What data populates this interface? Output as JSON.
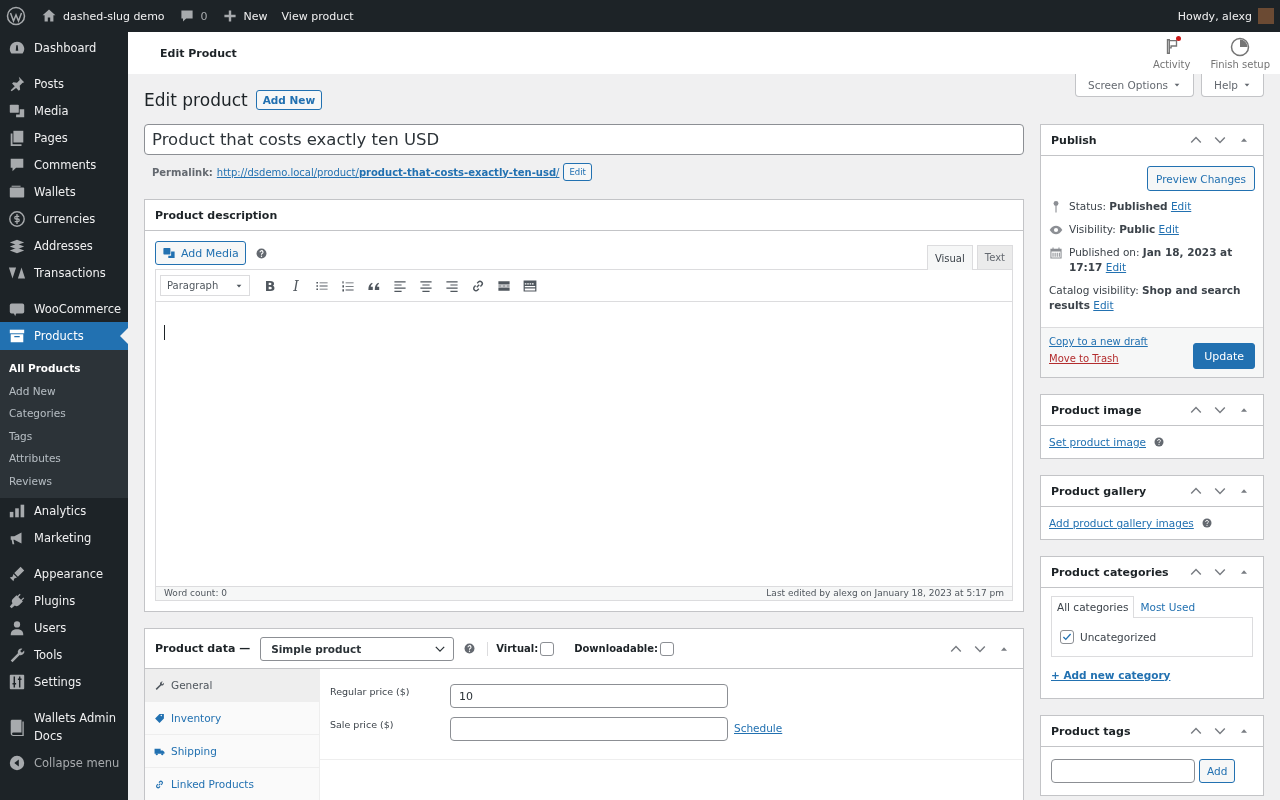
{
  "admin_bar": {
    "site_name": "dashed-slug demo",
    "comments_count": "0",
    "new_label": "New",
    "view_label": "View product",
    "greeting": "Howdy, alexg"
  },
  "sidebar": {
    "items": [
      {
        "kind": "item",
        "label": "Dashboard",
        "selected": false
      },
      {
        "kind": "separator"
      },
      {
        "kind": "item",
        "label": "Posts",
        "selected": false
      },
      {
        "kind": "item",
        "label": "Media",
        "selected": false
      },
      {
        "kind": "item",
        "label": "Pages",
        "selected": false
      },
      {
        "kind": "item",
        "label": "Comments",
        "selected": false
      },
      {
        "kind": "item",
        "label": "Wallets",
        "selected": false
      },
      {
        "kind": "item",
        "label": "Currencies",
        "selected": false
      },
      {
        "kind": "item",
        "label": "Addresses",
        "selected": false
      },
      {
        "kind": "item",
        "label": "Transactions",
        "selected": false
      },
      {
        "kind": "separator"
      },
      {
        "kind": "item",
        "label": "WooCommerce",
        "selected": false
      },
      {
        "kind": "item",
        "label": "Products",
        "selected": true,
        "children": [
          {
            "label": "All Products",
            "selected": true
          },
          {
            "label": "Add New",
            "selected": false
          },
          {
            "label": "Categories",
            "selected": false
          },
          {
            "label": "Tags",
            "selected": false
          },
          {
            "label": "Attributes",
            "selected": false
          },
          {
            "label": "Reviews",
            "selected": false
          }
        ]
      },
      {
        "kind": "item",
        "label": "Analytics",
        "selected": false
      },
      {
        "kind": "item",
        "label": "Marketing",
        "selected": false
      },
      {
        "kind": "separator"
      },
      {
        "kind": "item",
        "label": "Appearance",
        "selected": false
      },
      {
        "kind": "item",
        "label": "Plugins",
        "selected": false
      },
      {
        "kind": "item",
        "label": "Users",
        "selected": false
      },
      {
        "kind": "item",
        "label": "Tools",
        "selected": false
      },
      {
        "kind": "item",
        "label": "Settings",
        "selected": false
      },
      {
        "kind": "separator"
      },
      {
        "kind": "item",
        "label": "Wallets Admin Docs",
        "selected": false
      }
    ],
    "collapse_label": "Collapse menu"
  },
  "header": {
    "title": "Edit Product",
    "activity_label": "Activity",
    "activity_unread": true,
    "finish_setup_label": "Finish setup",
    "screen_options_label": "Screen Options",
    "help_label": "Help"
  },
  "heading": {
    "title": "Edit product",
    "add_new_label": "Add New"
  },
  "title_field": {
    "value": "Product that costs exactly ten USD"
  },
  "permalink": {
    "label": "Permalink:",
    "url": "http://dsdemo.local/product/**product-that-costs-exactly-ten-usd**/",
    "edit_label": "Edit"
  },
  "description_box": {
    "title": "Product description",
    "add_media_label": "Add Media",
    "editor_tabs": [
      {
        "label": "Visual",
        "selected": true
      },
      {
        "label": "Text",
        "selected": false
      }
    ],
    "format_select": "Paragraph",
    "toolbar": [
      {
        "kind": "text",
        "text": "B"
      },
      {
        "kind": "text",
        "text": "I"
      },
      {
        "kind": "icon"
      },
      {
        "kind": "icon"
      },
      {
        "kind": "icon"
      },
      {
        "kind": "icon"
      },
      {
        "kind": "icon"
      },
      {
        "kind": "icon"
      },
      {
        "kind": "icon"
      },
      {
        "kind": "icon"
      },
      {
        "kind": "icon"
      }
    ],
    "word_count": "Word count: 0",
    "last_edited": "Last edited by alexg on January 18, 2023 at 5:17 pm"
  },
  "product_data": {
    "title": "Product data —",
    "type_select": "Simple product",
    "virtual": {
      "label": "Virtual:",
      "checked": false
    },
    "downloadable": {
      "label": "Downloadable:",
      "checked": false
    },
    "tabs": [
      {
        "label": "General",
        "selected": true
      },
      {
        "label": "Inventory",
        "selected": false
      },
      {
        "label": "Shipping",
        "selected": false
      },
      {
        "label": "Linked Products",
        "selected": false
      }
    ],
    "fields": [
      {
        "label": "Regular price ($)",
        "value": "10"
      },
      {
        "label": "Sale price ($)",
        "link": "Schedule"
      }
    ]
  },
  "publish": {
    "title": "Publish",
    "preview_label": "Preview Changes",
    "rows": [
      {
        "text": "Status: **Published**",
        "link": "Edit"
      },
      {
        "text": "Visibility: **Public**",
        "link": "Edit"
      },
      {
        "text": "Published on: **Jan 18, 2023 at 17:17**",
        "link": "Edit"
      },
      {
        "text": "Catalog visibility: **Shop and search results**",
        "link": "Edit"
      }
    ],
    "copy_label": "Copy to a new draft",
    "trash_label": "Move to Trash",
    "update_label": "Update"
  },
  "product_image": {
    "title": "Product image",
    "link": "Set product image"
  },
  "product_gallery": {
    "title": "Product gallery",
    "link": "Add product gallery images"
  },
  "categories": {
    "title": "Product categories",
    "tabs": [
      {
        "label": "All categories",
        "selected": true
      },
      {
        "label": "Most Used",
        "selected": false
      }
    ],
    "items": [
      {
        "label": "Uncategorized",
        "checked": true
      }
    ],
    "add_link": "+ Add new category"
  },
  "tags": {
    "title": "Product tags",
    "add_label": "Add"
  }
}
